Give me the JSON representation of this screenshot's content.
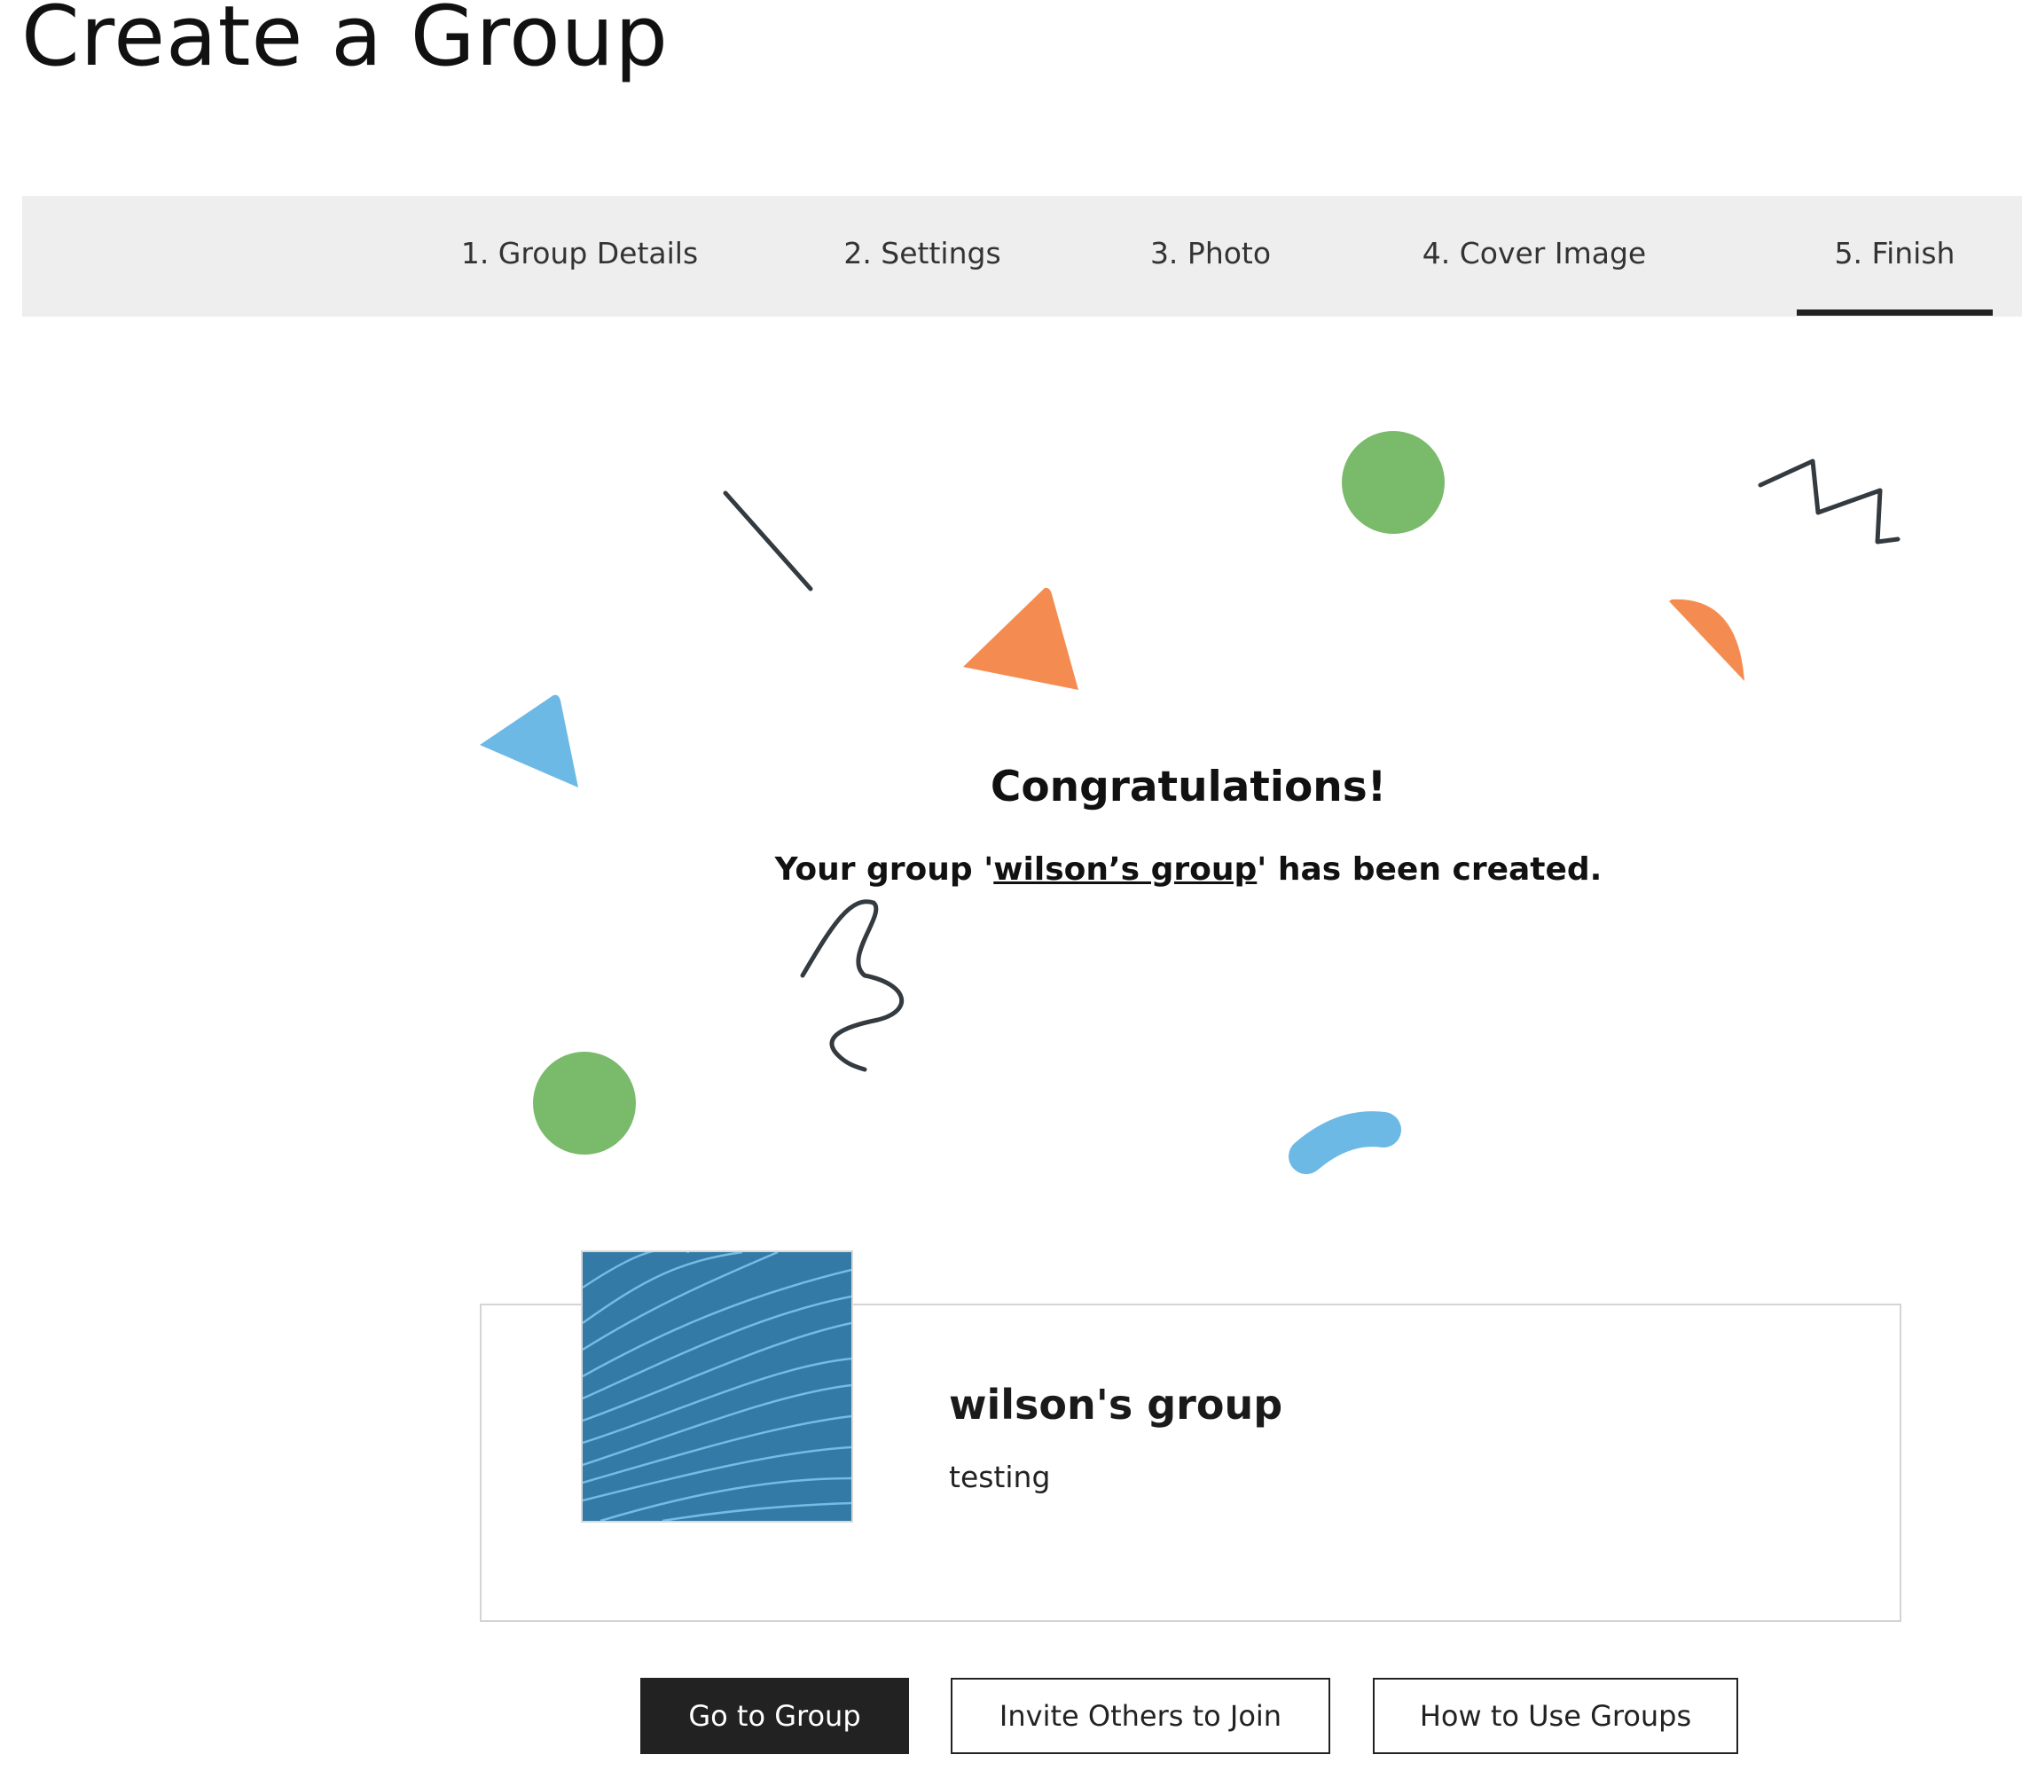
{
  "page": {
    "title": "Create a Group"
  },
  "steps": [
    {
      "label": "1. Group Details",
      "active": false
    },
    {
      "label": "2. Settings",
      "active": false
    },
    {
      "label": "3. Photo",
      "active": false
    },
    {
      "label": "4. Cover Image",
      "active": false
    },
    {
      "label": "5. Finish",
      "active": true
    }
  ],
  "confirmation": {
    "heading": "Congratulations!",
    "message_prefix": "Your group '",
    "group_link": "wilson’s group",
    "message_suffix": "' has been created."
  },
  "group_card": {
    "name": "wilson's group",
    "description": "testing",
    "thumbnail_icon": "wave-pattern-image"
  },
  "actions": {
    "go_to_group": "Go to Group",
    "invite": "Invite Others to Join",
    "how_to": "How to Use Groups"
  },
  "colors": {
    "confetti_green": "#7aba6b",
    "confetti_orange": "#f48c52",
    "confetti_blue": "#6db9e5",
    "confetti_line": "#333a40",
    "thumbnail_blue": "#347aa6",
    "primary_button": "#222222"
  }
}
